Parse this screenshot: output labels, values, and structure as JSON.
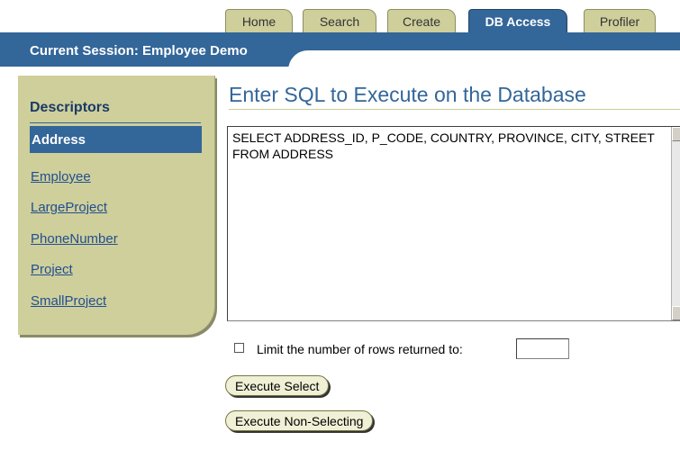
{
  "tabs": [
    {
      "label": "Home",
      "active": false
    },
    {
      "label": "Search",
      "active": false
    },
    {
      "label": "Create",
      "active": false
    },
    {
      "label": "DB Access",
      "active": true
    },
    {
      "label": "Profiler",
      "active": false
    }
  ],
  "header": {
    "session_label": "Current Session: Employee Demo"
  },
  "sidebar": {
    "title": "Descriptors",
    "active_item": "Address",
    "items": [
      "Employee",
      "LargeProject",
      "PhoneNumber",
      "Project",
      "SmallProject"
    ]
  },
  "main": {
    "title": "Enter SQL to Execute on the Database",
    "sql_text": "SELECT ADDRESS_ID, P_CODE, COUNTRY, PROVINCE, CITY, STREET FROM ADDRESS",
    "limit_label": "Limit the number of rows returned to:",
    "limit_value": "",
    "limit_checked": false,
    "execute_select_label": "Execute Select",
    "execute_non_selecting_label": "Execute Non-Selecting"
  },
  "colors": {
    "accent": "#336699",
    "tab_bg": "#cfcf9c",
    "sidebar_bg": "#cfcf9c"
  }
}
